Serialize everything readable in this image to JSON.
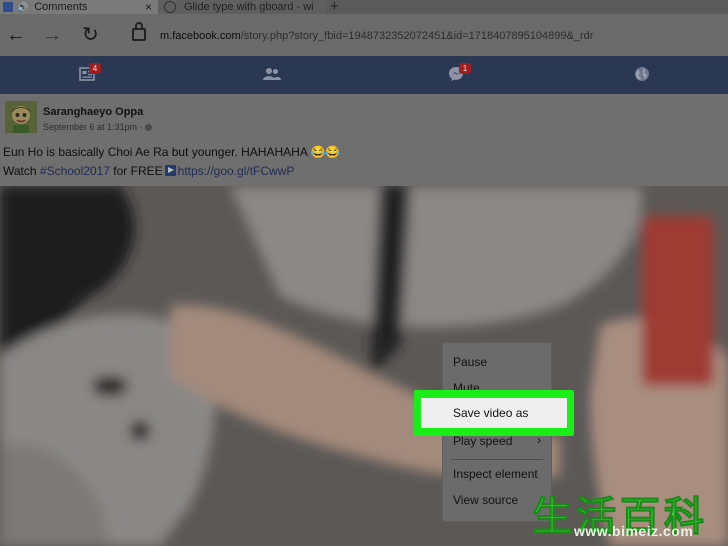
{
  "browser": {
    "tabs": [
      {
        "title": "Comments",
        "icon": "facebook-favicon",
        "audio_icon": "speaker-icon"
      },
      {
        "title": "Glide type with gboard - wi",
        "icon": "loading-spinner-icon"
      }
    ],
    "close_glyph": "×",
    "new_tab_glyph": "+",
    "url_host": "m.facebook.com",
    "url_path": "/story.php?story_fbid=1948732352072451&id=1718407895104899&_rdr"
  },
  "fb_nav": {
    "notifications_count": "4",
    "messages_count": "1"
  },
  "post": {
    "author": "Saranghaeyo Oppa",
    "meta": "September 6 at 1:31pm · ",
    "text_line1": "Eun Ho is basically Choi Ae Ra but younger. HAHAHAHA 😂😂",
    "text_line2_prefix": "Watch ",
    "hashtag": "#School2017",
    "text_line2_mid": " for FREE",
    "link": "https://goo.gl/tFCwwP"
  },
  "context_menu": {
    "items": [
      "Pause",
      "Mute",
      "Save video as",
      "Play speed",
      "Inspect element",
      "View source"
    ],
    "submenu_glyph": "›"
  },
  "watermark": {
    "cjk": "生活百科",
    "url": "www.bimeiz.com"
  },
  "colors": {
    "highlight": "#19ee19",
    "fb_blue_dimmed": "#2a3854",
    "watermark_green": "#3fd13a"
  }
}
